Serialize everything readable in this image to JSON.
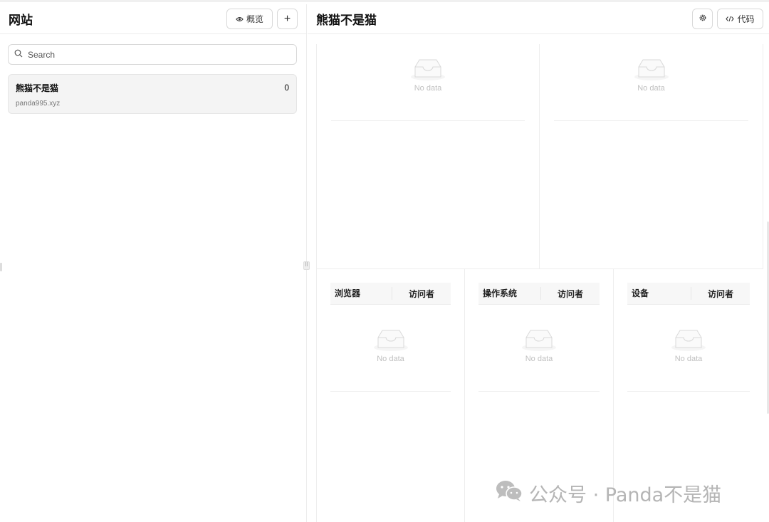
{
  "left_panel": {
    "title": "网站",
    "overview_label": "概览",
    "add_label": "+",
    "search": {
      "placeholder": "Search",
      "value": ""
    },
    "sites": [
      {
        "name": "熊猫不是猫",
        "domain": "panda995.xyz",
        "count": "0"
      }
    ]
  },
  "right_panel": {
    "title": "熊猫不是猫",
    "code_label": "代码",
    "charts": [
      {
        "empty_text": "No data"
      },
      {
        "empty_text": "No data"
      }
    ],
    "tables": [
      {
        "col1": "浏览器",
        "col2": "访问者",
        "empty_text": "No data"
      },
      {
        "col1": "操作系统",
        "col2": "访问者",
        "empty_text": "No data"
      },
      {
        "col1": "设备",
        "col2": "访问者",
        "empty_text": "No data"
      }
    ]
  },
  "watermark": {
    "text": "公众号 · Panda不是猫"
  },
  "icons": {
    "overview": "eye-icon",
    "search": "search-icon",
    "settings": "gear-icon",
    "code": "code-icon",
    "empty": "inbox-icon",
    "watermark": "wechat-icon"
  }
}
